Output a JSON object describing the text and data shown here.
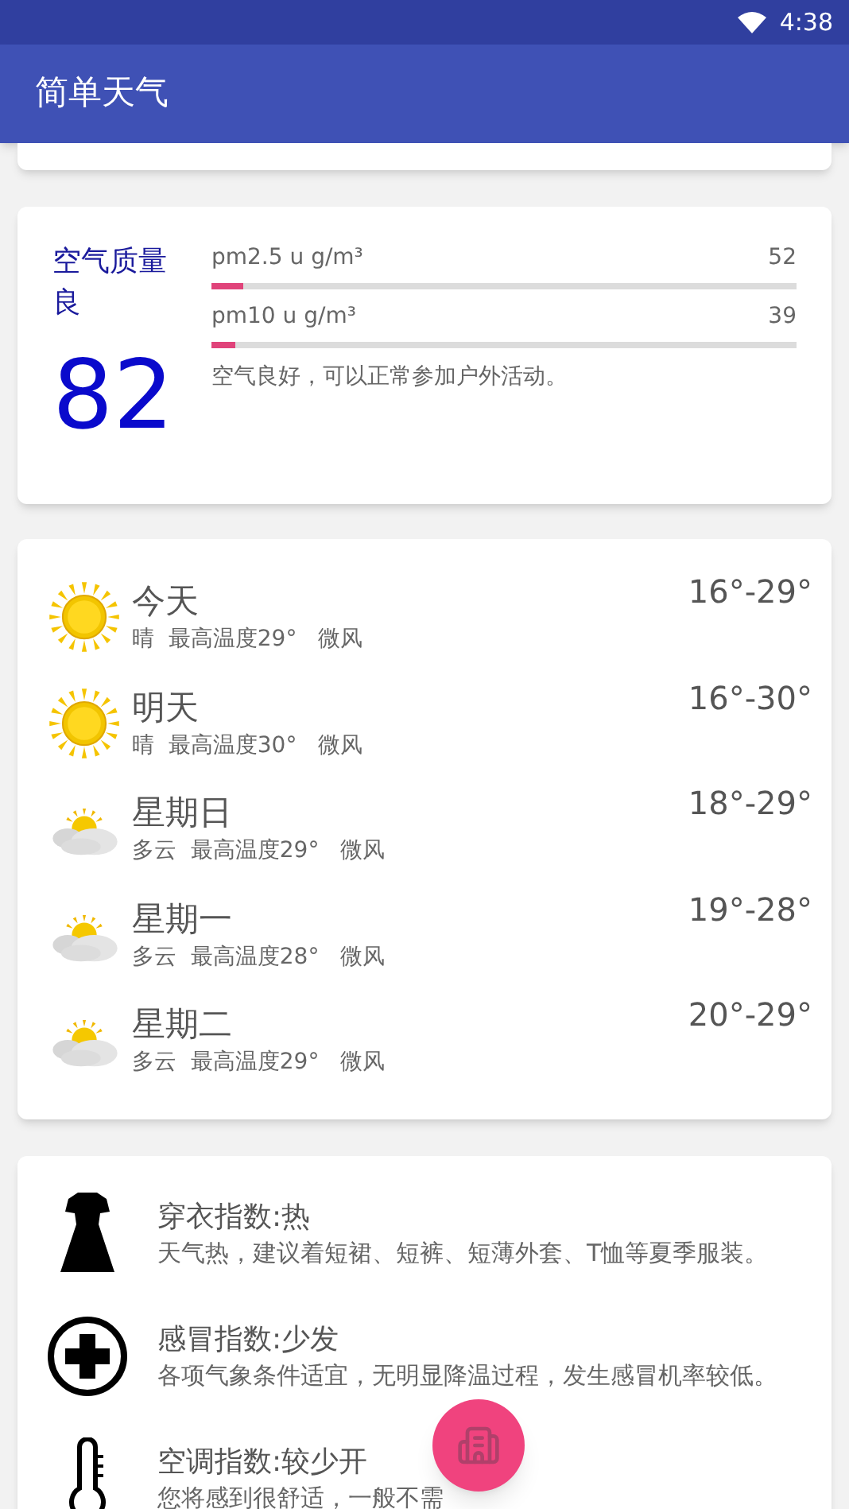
{
  "status_bar": {
    "time": "4:38"
  },
  "app_bar": {
    "title": "简单天气"
  },
  "air_quality": {
    "title": "空气质量",
    "grade": "良",
    "aqi": "82",
    "pollutants": [
      {
        "label": "pm2.5 u g/m³",
        "value": "52",
        "level": 0.055
      },
      {
        "label": "pm10 u g/m³",
        "value": "39",
        "level": 0.04
      }
    ],
    "advice": "空气良好，可以正常参加户外活动。"
  },
  "forecast": [
    {
      "kind": "sunny",
      "day": "今天",
      "detail": "晴  最高温度29°   微风",
      "range": "16°-29°"
    },
    {
      "kind": "sunny",
      "day": "明天",
      "detail": "晴  最高温度30°   微风",
      "range": "16°-30°"
    },
    {
      "kind": "cloudy",
      "day": "星期日",
      "detail": "多云  最高温度29°   微风",
      "range": "18°-29°"
    },
    {
      "kind": "cloudy",
      "day": "星期一",
      "detail": "多云  最高温度28°   微风",
      "range": "19°-28°"
    },
    {
      "kind": "cloudy",
      "day": "星期二",
      "detail": "多云  最高温度29°   微风",
      "range": "20°-29°"
    }
  ],
  "life_indices": [
    {
      "kind": "clothing",
      "title": "穿衣指数:热",
      "text": "天气热，建议着短裙、短裤、短薄外套、T恤等夏季服装。"
    },
    {
      "kind": "cold",
      "title": "感冒指数:少发",
      "text": "各项气象条件适宜，无明显降温过程，发生感冒机率较低。"
    },
    {
      "kind": "aircon",
      "title": "空调指数:较少开",
      "text": "您将感到很舒适，一般不需"
    }
  ]
}
